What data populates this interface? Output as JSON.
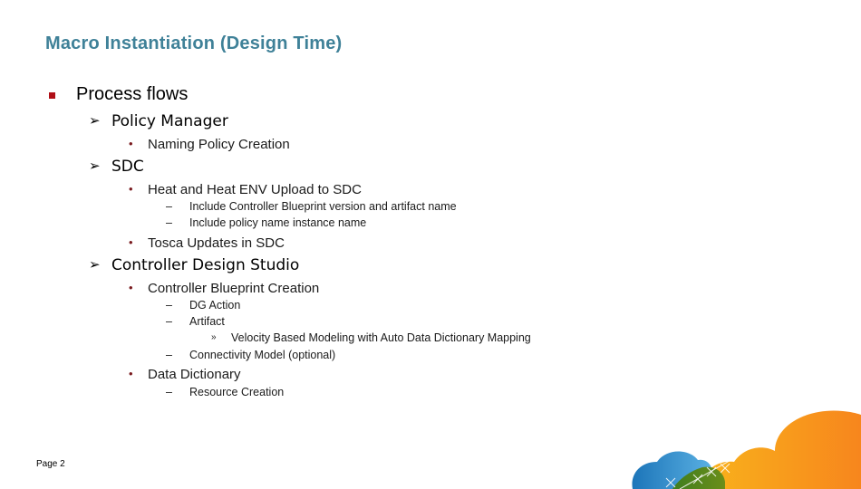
{
  "slide": {
    "title": "Macro Instantiation (Design Time)",
    "page_label": "Page 2"
  },
  "bullets": {
    "square": "▪",
    "arrow": "Ø",
    "dot": "•",
    "dash": "–",
    "chevron": "»"
  },
  "outline": {
    "l1": "Process flows",
    "policy_manager": {
      "label": "Policy Manager",
      "items": [
        "Naming Policy Creation"
      ]
    },
    "sdc": {
      "label": "SDC",
      "heat": "Heat and Heat ENV Upload to SDC",
      "heat_subitems": [
        "Include Controller Blueprint version and artifact name",
        "Include policy name instance name"
      ],
      "tosca": "Tosca Updates in SDC"
    },
    "cds": {
      "label": "Controller Design Studio",
      "blueprint": "Controller Blueprint Creation",
      "blueprint_subitems": [
        "DG Action",
        "Artifact",
        "Connectivity Model (optional)"
      ],
      "artifact_subitem": "Velocity Based Modeling with Auto Data Dictionary Mapping",
      "data_dictionary": "Data Dictionary",
      "data_dictionary_subitems": [
        "Resource Creation"
      ]
    }
  },
  "colors": {
    "title": "#3f8198",
    "square_bullet": "#b00f17",
    "cloud_orange": "#f7941d",
    "cloud_blue": "#2f8fcf",
    "cloud_green": "#5a8a1e"
  }
}
